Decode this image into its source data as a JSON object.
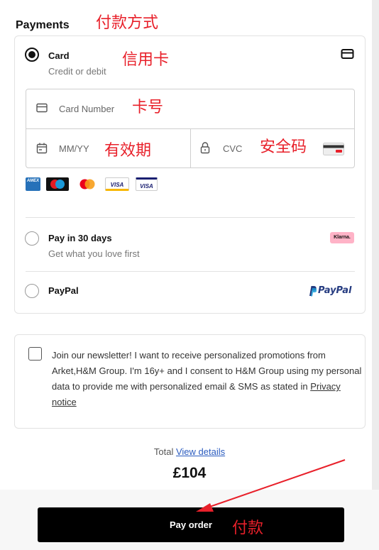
{
  "section_title": "Payments",
  "annotations": {
    "payment_method": "付款方式",
    "credit_card": "信用卡",
    "card_number": "卡号",
    "expiry": "有效期",
    "security_code": "安全码",
    "pay": "付款"
  },
  "options": {
    "card": {
      "title": "Card",
      "subtitle": "Credit or debit",
      "selected": true
    },
    "pay_later": {
      "title": "Pay in 30 days",
      "subtitle": "Get what you love first",
      "badge": "Klarna."
    },
    "paypal": {
      "title": "PayPal",
      "logo_text": "PayPal"
    }
  },
  "card_form": {
    "number_placeholder": "Card Number",
    "expiry_placeholder": "MM/YY",
    "cvc_placeholder": "CVC"
  },
  "card_brands": [
    {
      "name": "AMEX",
      "icon": "amex-logo"
    },
    {
      "name": "maestro",
      "icon": "maestro-logo"
    },
    {
      "name": "mastercard",
      "icon": "mastercard-logo"
    },
    {
      "name": "VISA",
      "icon": "visa-logo"
    },
    {
      "name": "VISA",
      "icon": "visa-electron-logo"
    }
  ],
  "newsletter": {
    "text": "Join our newsletter! I want to receive personalized promotions from Arket,H&M Group. I'm 16y+ and I consent to H&M Group using my personal data to provide me with personalized email & SMS as stated in ",
    "link": "Privacy notice",
    "checked": false
  },
  "total": {
    "label": "Total",
    "details_link": "View details",
    "amount": "£104"
  },
  "pay_button": "Pay order",
  "colors": {
    "annotation_red": "#e8202a",
    "button_bg": "#000000",
    "link_blue": "#2a5bbf",
    "klarna_pink": "#ffb3c7",
    "paypal_dark_blue": "#253b80",
    "paypal_light_blue": "#179bd7"
  }
}
